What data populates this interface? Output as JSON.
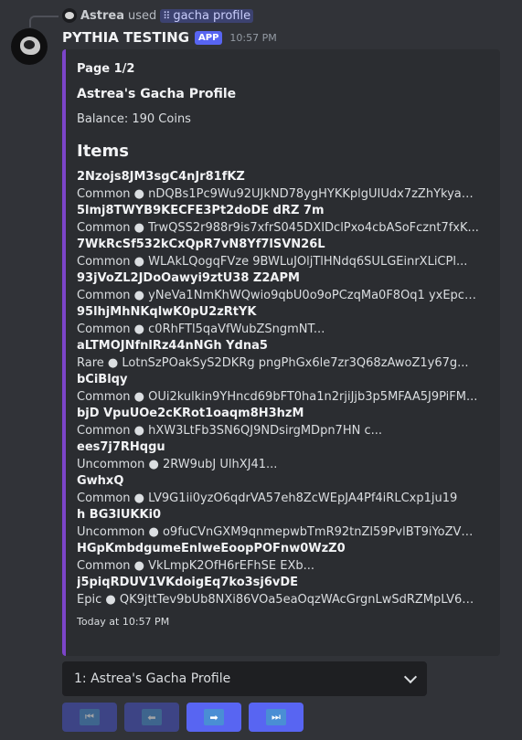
{
  "reply": {
    "username": "Astrea",
    "action": "used",
    "command": "gacha profile"
  },
  "message": {
    "author": "PYTHIA TESTING",
    "tag": "APP",
    "time": "10:57 PM"
  },
  "embed": {
    "page_label": "Page 1/2",
    "title": "Astrea's Gacha Profile",
    "balance": "Balance: 190 Coins",
    "items_heading": "Items",
    "items": [
      {
        "name": "2Nzojs8JM3sgC4nJr81fKZ",
        "desc": "Common ● nDQBs1Pc9Wu92UJkND78ygHYKKplgUIUdx7zZhYkya8dBbW..."
      },
      {
        "name": "5lmj8TWYB9KECFE3Pt2doDE dRZ 7m",
        "desc": "Common ● TrwQSS2r988r9is7xfrS045DXIDclPxo4cbASoFcznt7fxK..."
      },
      {
        "name": "7WkRcSf532kCxQpR7vN8Yf7lSVN26L",
        "desc": "Common ● WLAkLQogqFVze 9BWLuJOljTlHNdq6SULGEinrXLiCPl..."
      },
      {
        "name": "93jVoZL2JDoOawyi9ztU38 Z2APM",
        "desc": "Common ● yNeVa1NmKhWQwio9qbU0o9oPCzqMa0F8Oq1 yxEpce..."
      },
      {
        "name": "95lhjMhNKqlwK0pU2zRtYK",
        "desc": "Common ● c0RhFTl5qaVfWubZSngmNT..."
      },
      {
        "name": "aLTMOJNfnlRz44nNGh Ydna5",
        "desc": "Rare ● LotnSzPOakSyS2DKRg pngPhGx6le7zr3Q68zAwoZ1y67g..."
      },
      {
        "name": "bCiBlqy",
        "desc": "Common ● OUi2kulkin9YHncd69bFT0ha1n2rjiJjb3p5MFAA5J9PiFM..."
      },
      {
        "name": "bjD VpuUOe2cKRot1oaqm8H3hzM",
        "desc": "Common ● hXW3LtFb3SN6QJ9NDsirgMDpn7HN c..."
      },
      {
        "name": "ees7j7RHqgu",
        "desc": "Uncommon ● 2RW9ubJ UlhXJ41..."
      },
      {
        "name": "GwhxQ",
        "desc": "Common ● LV9G1ii0yzO6qdrVA57eh8ZcWEpJA4Pf4iRLCxp1ju19"
      },
      {
        "name": "h BG3lUKKi0",
        "desc": "Uncommon ● o9fuCVnGXM9qnmepwbTmR92tnZl59PvlBT9iYoZV24t5pU7..."
      },
      {
        "name": "HGpKmbdgumeEnlweEoopPOFnw0WzZ0",
        "desc": "Common ● VkLmpK2OfH6rEFhSE EXb..."
      },
      {
        "name": "j5piqRDUV1VKdoigEq7ko3sj6vDE",
        "desc": "Epic ● QK9jttTev9bUb8NXi86VOa5eaOqzWAcGrgnLwSdRZMpLV60..."
      }
    ],
    "footer": "Today at 10:57 PM",
    "accent_color": "#7c45c9"
  },
  "select": {
    "selected": "1: Astrea's Gacha Profile"
  },
  "buttons": [
    {
      "icon": "first-page-icon",
      "glyph": "⏮"
    },
    {
      "icon": "previous-page-icon",
      "glyph": "⬅"
    },
    {
      "icon": "next-page-icon",
      "glyph": "➡"
    },
    {
      "icon": "last-page-icon",
      "glyph": "⏭"
    }
  ]
}
